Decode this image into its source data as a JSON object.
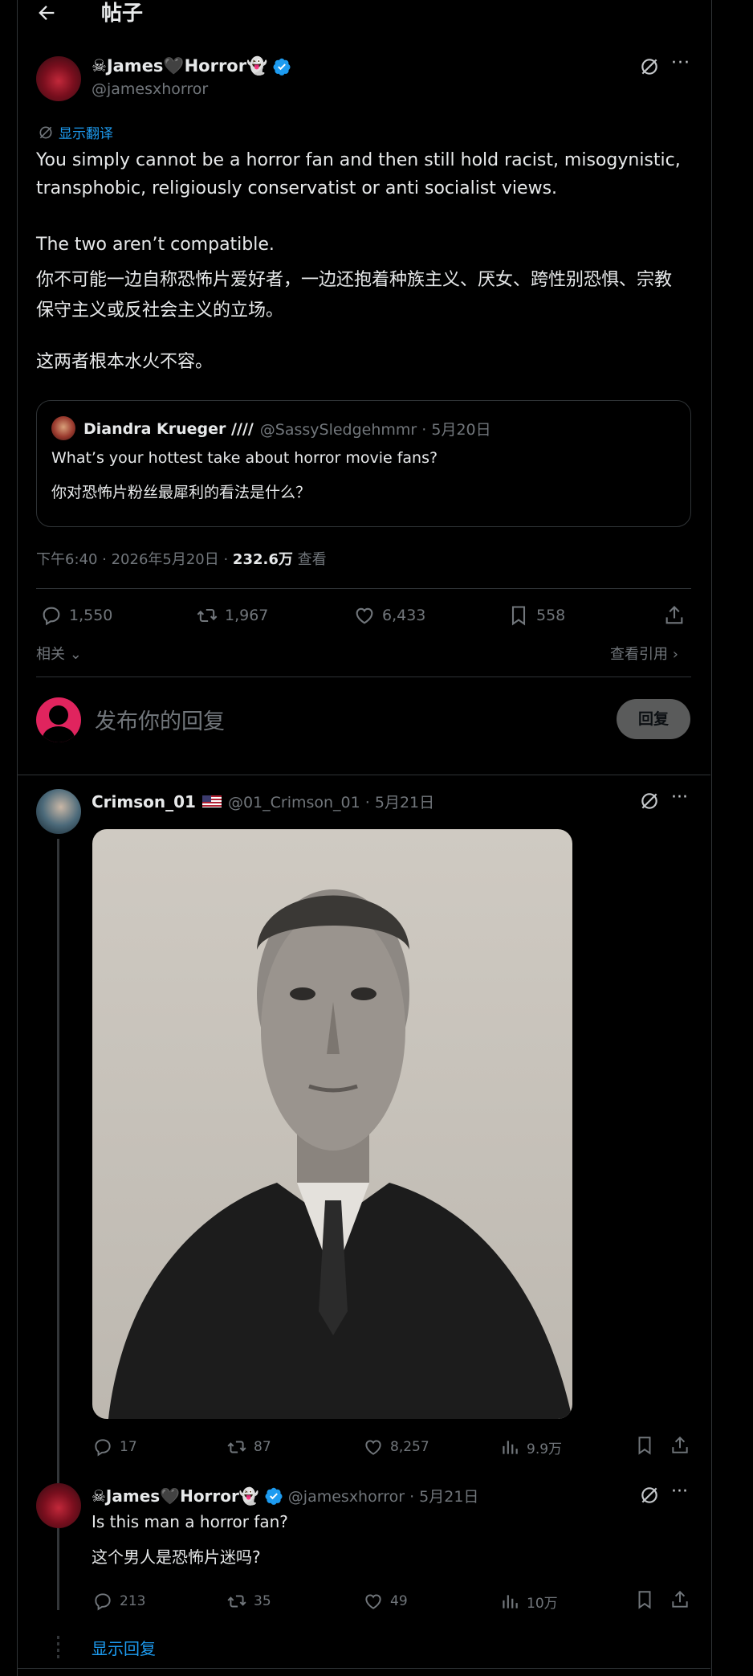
{
  "header": {
    "title": "帖子"
  },
  "post": {
    "author_name": "☠James🖤Horror👻",
    "author_handle": "@jamesxhorror",
    "show_translation": "显示翻译",
    "text_en_1": "You simply cannot be a horror fan and then still hold racist, misogynistic, transphobic, religiously conservatist or anti socialist views.",
    "text_en_2": "The two aren’t compatible.",
    "text_zh_1": "你不可能一边自称恐怖片爱好者，一边还抱着种族主义、厌女、跨性别恐惧、宗教保守主义或反社会主义的立场。",
    "text_zh_2": "这两者根本水火不容。",
    "quote": {
      "name": "Diandra Krueger ////",
      "handle_date": "@SassySledgehmmr · 5月20日",
      "text_en": "What’s your hottest take about horror movie fans?",
      "text_zh": "你对恐怖片粉丝最犀利的看法是什么？"
    },
    "meta_time": "下午6:40 · 2026年5月20日 · ",
    "meta_views_count": "232.6万",
    "meta_views_label": " 查看",
    "replies": "1,550",
    "retweets": "1,967",
    "likes": "6,433",
    "bookmarks": "558",
    "related": "相关",
    "view_quotes": "查看引用",
    "reply_placeholder": "发布你的回复",
    "reply_button": "回复"
  },
  "reply1": {
    "author_name": "Crimson_01",
    "author_handle_date": "@01_Crimson_01 · 5月21日",
    "replies": "17",
    "retweets": "87",
    "likes": "8,257",
    "views": "9.9万"
  },
  "reply2": {
    "author_name": "☠James🖤Horror👻",
    "author_handle_date": "@jamesxhorror · 5月21日",
    "text_en": "Is this man a horror fan?",
    "text_zh": "这个男人是恐怖片迷吗?",
    "replies": "213",
    "retweets": "35",
    "likes": "49",
    "views": "10万",
    "show_replies": "显示回复"
  },
  "colors": {
    "accent": "#1d9bf0",
    "background": "#000000",
    "muted": "#71767b",
    "text": "#e7e9ea"
  }
}
